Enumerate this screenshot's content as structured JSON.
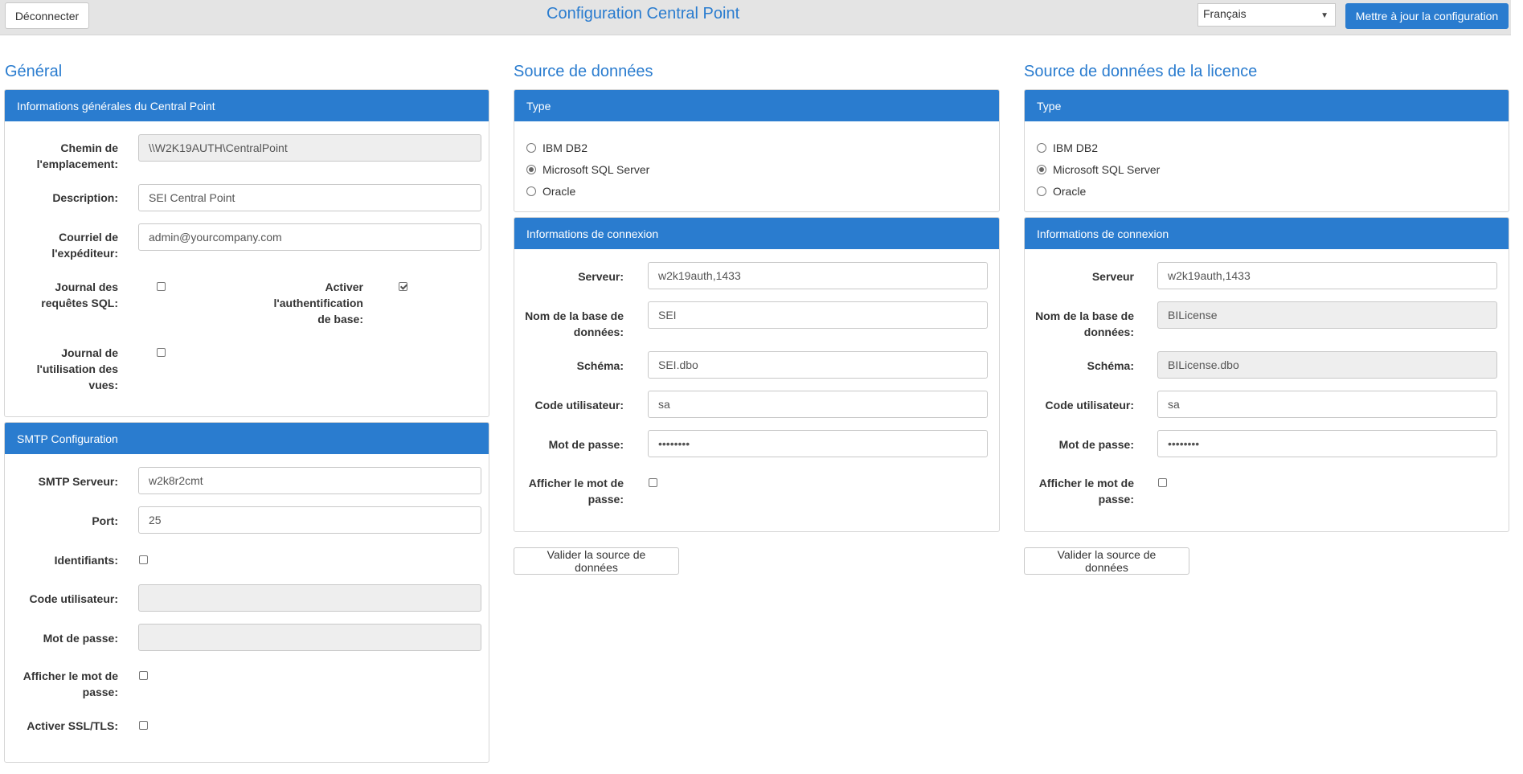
{
  "header": {
    "logout_label": "Déconnecter",
    "title": "Configuration Central Point",
    "language": "Français",
    "update_label": "Mettre à jour la configuration"
  },
  "general": {
    "title": "Général",
    "info_panel": {
      "header": "Informations générales du Central Point",
      "path_label": "Chemin de l'emplacement:",
      "path_value": "\\\\W2K19AUTH\\CentralPoint",
      "description_label": "Description:",
      "description_value": "SEI Central Point",
      "email_label": "Courriel de l'expéditeur:",
      "email_value": "admin@yourcompany.com",
      "sql_log_label": "Journal des requêtes SQL:",
      "basic_auth_label": "Activer l'authentification de base:",
      "view_log_label": "Journal de l'utilisation des vues:"
    },
    "smtp_panel": {
      "header": "SMTP Configuration",
      "server_label": "SMTP Serveur:",
      "server_value": "w2k8r2cmt",
      "port_label": "Port:",
      "port_value": "25",
      "credentials_label": "Identifiants:",
      "user_label": "Code utilisateur:",
      "password_label": "Mot de passe:",
      "show_password_label": "Afficher le mot de passe:",
      "ssl_label": "Activer SSL/TLS:"
    }
  },
  "datasource": {
    "title": "Source de données",
    "type_header": "Type",
    "types": [
      "IBM DB2",
      "Microsoft SQL Server",
      "Oracle"
    ],
    "conn_header": "Informations de connexion",
    "server_label": "Serveur:",
    "server_value": "w2k19auth,1433",
    "db_label": "Nom de la base de données:",
    "db_value": "SEI",
    "schema_label": "Schéma:",
    "schema_value": "SEI.dbo",
    "user_label": "Code utilisateur:",
    "user_value": "sa",
    "password_label": "Mot de passe:",
    "password_value": "••••••••",
    "show_password_label": "Afficher le mot de passe:",
    "validate_label": "Valider la source de données"
  },
  "license": {
    "title": "Source de données de la licence",
    "type_header": "Type",
    "types": [
      "IBM DB2",
      "Microsoft SQL Server",
      "Oracle"
    ],
    "conn_header": "Informations de connexion",
    "server_label": "Serveur",
    "server_value": "w2k19auth,1433",
    "db_label": "Nom de la base de données:",
    "db_value": "BILicense",
    "schema_label": "Schéma:",
    "schema_value": "BILicense.dbo",
    "user_label": "Code utilisateur:",
    "user_value": "sa",
    "password_label": "Mot de passe:",
    "password_value": "••••••••",
    "show_password_label": "Afficher le mot de passe:",
    "validate_label": "Valider la source de données"
  },
  "colors": {
    "accent": "#2a7ccf",
    "topbar": "#e4e4e4",
    "disabled_input": "#eeeeee"
  }
}
